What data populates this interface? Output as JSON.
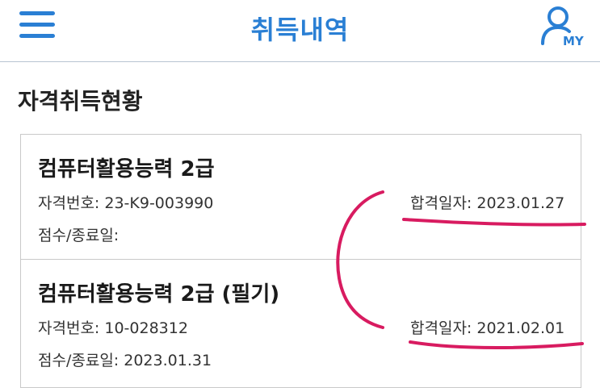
{
  "header": {
    "title": "취득내역",
    "my_label": "MY"
  },
  "section_title": "자격취득현황",
  "certs": [
    {
      "name": "컴퓨터활용능력 2급",
      "number_label": "자격번호:",
      "number": "23-K9-003990",
      "pass_label": "합격일자:",
      "pass_date": "2023.01.27",
      "score_label": "점수/종료일:",
      "score": ""
    },
    {
      "name": "컴퓨터활용능력 2급 (필기)",
      "number_label": "자격번호:",
      "number": "10-028312",
      "pass_label": "합격일자:",
      "pass_date": "2021.02.01",
      "score_label": "점수/종료일:",
      "score": "2023.01.31"
    }
  ],
  "colors": {
    "accent": "#2a7fd4",
    "annotation": "#d81b60",
    "divider": "#c9c9c9"
  }
}
